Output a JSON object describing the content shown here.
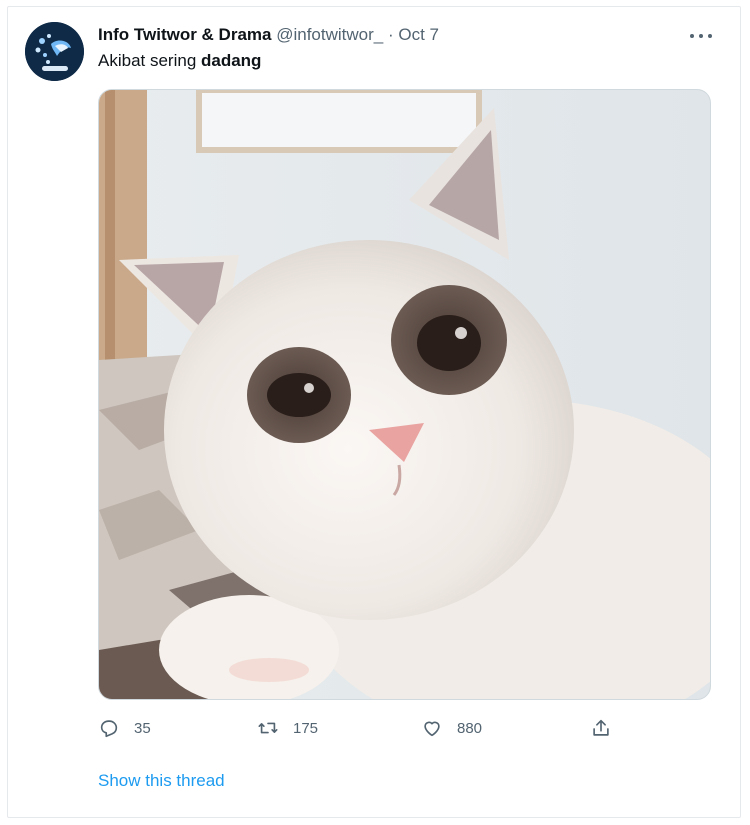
{
  "tweet": {
    "display_name": "Info Twitwor & Drama",
    "handle": "@infotwitwor_",
    "separator": "·",
    "date": "Oct 7",
    "text_prefix": "Akibat sering ",
    "text_bold": "dadang",
    "actions": {
      "reply_count": "35",
      "retweet_count": "175",
      "like_count": "880"
    },
    "show_thread_label": "Show this thread"
  },
  "icons": {
    "more": "more-horizontal-icon",
    "reply": "reply-icon",
    "retweet": "retweet-icon",
    "like": "heart-icon",
    "share": "share-icon"
  },
  "colors": {
    "link": "#1d9bf0",
    "secondary_text": "#536471",
    "avatar_bg": "#0e2a47"
  }
}
